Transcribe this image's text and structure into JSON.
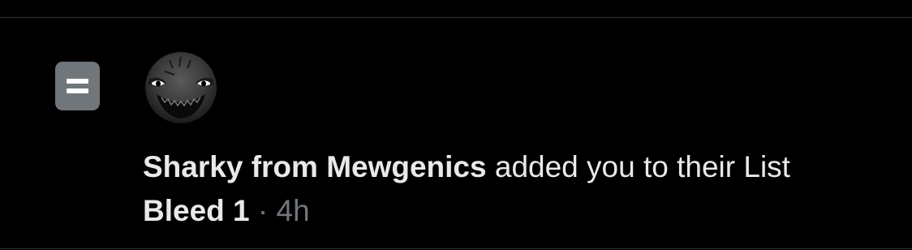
{
  "notification": {
    "icon": "list-icon",
    "avatar": "avatar-dark-creature",
    "user_name": "Sharky from Mewgenics",
    "action_text": " added you to their List",
    "list_name": "Bleed 1",
    "separator": " · ",
    "time": "4h"
  },
  "colors": {
    "background": "#000000",
    "primary_text": "#e7e9ea",
    "secondary_text": "#71767b",
    "icon_bg": "#71767b",
    "divider": "#2f3336"
  }
}
